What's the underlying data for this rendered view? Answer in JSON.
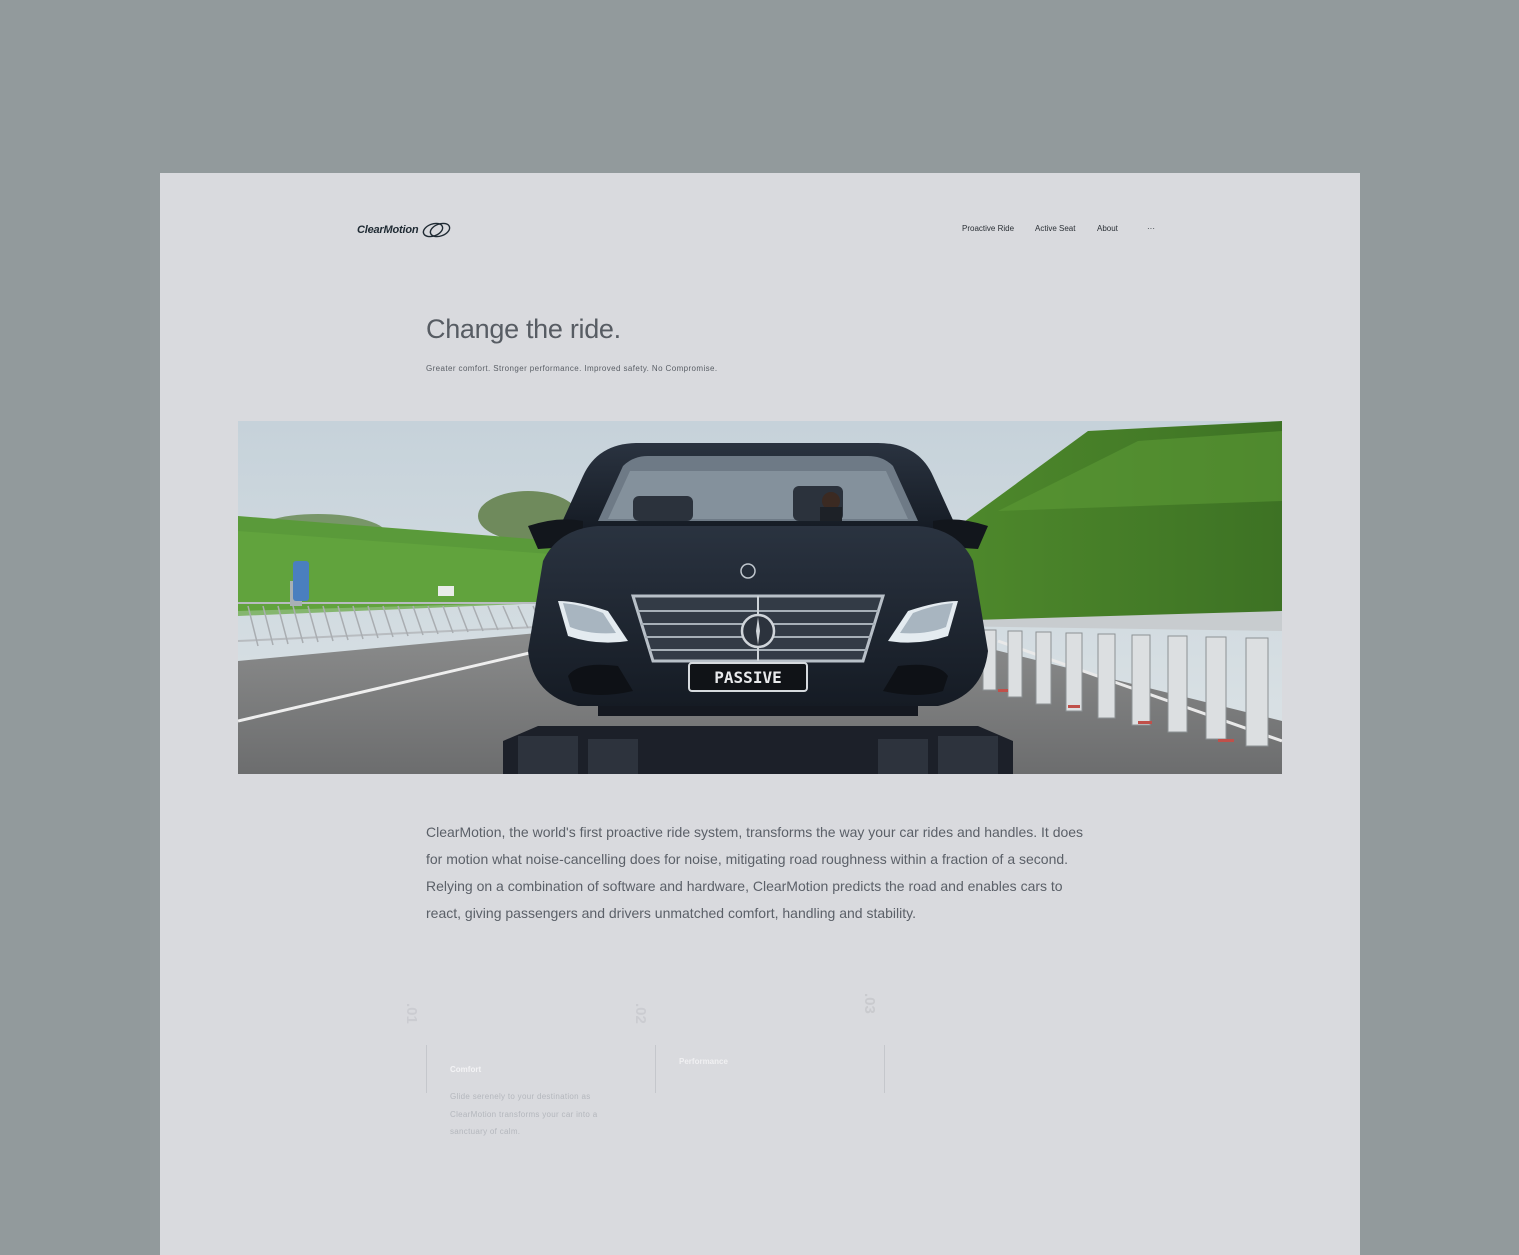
{
  "brand": {
    "name": "ClearMotion"
  },
  "nav": {
    "items": [
      "Proactive Ride",
      "Active Seat",
      "About",
      "···"
    ]
  },
  "hero": {
    "title": "Change the ride.",
    "subtitle": "Greater comfort. Stronger performance. Improved safety. No Compromise.",
    "image": {
      "plate_text": "PASSIVE"
    }
  },
  "intro": {
    "text": "ClearMotion, the world's first proactive ride system, transforms the way your car rides and handles. It does for motion what noise-cancelling does for noise, mitigating road roughness within a fraction of a second. Relying on a combination of software and hardware, ClearMotion predicts the road and enables cars to react, giving passengers and drivers unmatched comfort, handling and stability."
  },
  "features": [
    {
      "number": ".01",
      "title": "Comfort",
      "description": "Glide serenely to your destination as ClearMotion transforms your car into a sanctuary of calm."
    },
    {
      "number": ".02",
      "title": "Performance",
      "description": ""
    },
    {
      "number": ".03",
      "title": "",
      "description": ""
    }
  ],
  "colors": {
    "page_background": "#929a9c",
    "frame_background": "#d9dade",
    "text_primary": "#575c63",
    "brand_dark": "#1f2a33"
  },
  "icons": {
    "logo_mark": "interlocking-ovals-icon",
    "more": "ellipsis-icon"
  }
}
